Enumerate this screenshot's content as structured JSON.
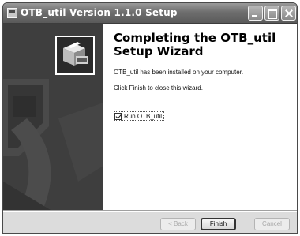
{
  "window": {
    "title": "OTB_util Version 1.1.0 Setup"
  },
  "page": {
    "heading": "Completing the OTB_util Setup Wizard",
    "installed_message": "OTB_util has been installed on your computer.",
    "close_message": "Click Finish to close this wizard."
  },
  "options": {
    "run_label": "Run OTB_util",
    "run_checked": true
  },
  "buttons": {
    "back": "< Back",
    "finish": "Finish",
    "cancel": "Cancel"
  },
  "colors": {
    "side_panel": "#3e3e3e",
    "titlebar": "#6e6e6e",
    "dialog_bg": "#dcdcdc"
  },
  "icons": {
    "app": "installer-window-icon",
    "side_logo": "installer-box-icon",
    "min": "minimize-icon",
    "max": "maximize-icon",
    "close": "close-icon"
  }
}
